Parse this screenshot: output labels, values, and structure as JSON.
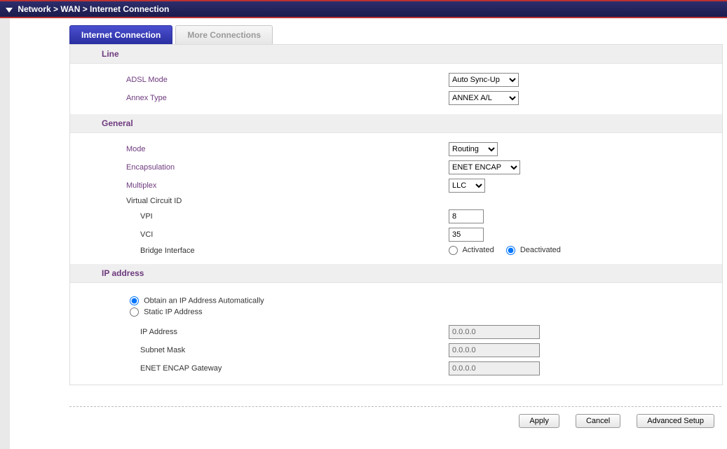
{
  "breadcrumb": "Network > WAN > Internet Connection",
  "tabs": {
    "active": "Internet Connection",
    "inactive": "More Connections"
  },
  "sections": {
    "line": {
      "title": "Line",
      "adsl_mode_label": "ADSL Mode",
      "adsl_mode_value": "Auto Sync-Up",
      "annex_type_label": "Annex Type",
      "annex_type_value": "ANNEX A/L"
    },
    "general": {
      "title": "General",
      "mode_label": "Mode",
      "mode_value": "Routing",
      "encap_label": "Encapsulation",
      "encap_value": "ENET ENCAP",
      "multiplex_label": "Multiplex",
      "multiplex_value": "LLC",
      "vcid_label": "Virtual Circuit ID",
      "vpi_label": "VPI",
      "vpi_value": "8",
      "vci_label": "VCI",
      "vci_value": "35",
      "bridge_label": "Bridge Interface",
      "bridge_activated": "Activated",
      "bridge_deactivated": "Deactivated",
      "bridge_selected": "deactivated"
    },
    "ip": {
      "title": "IP address",
      "obtain_label": "Obtain an IP Address Automatically",
      "static_label": "Static IP Address",
      "selected": "obtain",
      "ip_label": "IP Address",
      "ip_value": "0.0.0.0",
      "subnet_label": "Subnet Mask",
      "subnet_value": "0.0.0.0",
      "gw_label": "ENET ENCAP Gateway",
      "gw_value": "0.0.0.0"
    }
  },
  "buttons": {
    "apply": "Apply",
    "cancel": "Cancel",
    "advanced": "Advanced Setup"
  }
}
